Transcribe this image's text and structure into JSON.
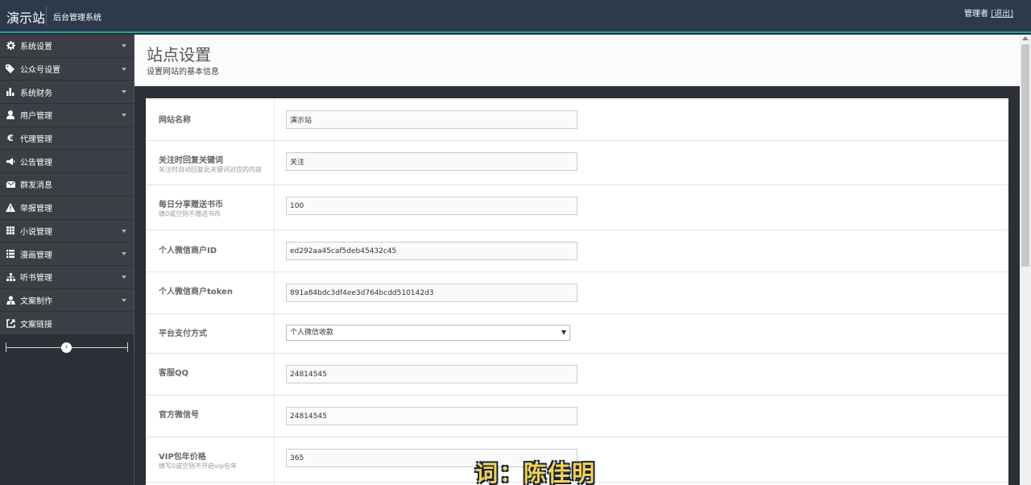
{
  "header": {
    "brand": "演示站",
    "subtitle": "后台管理系统",
    "user_name": "管理者",
    "logout_label": "[退出]"
  },
  "sidebar": {
    "items": [
      {
        "label": "系统设置",
        "icon": "gear-icon",
        "has_caret": true
      },
      {
        "label": "公众号设置",
        "icon": "tag-icon",
        "has_caret": true
      },
      {
        "label": "系统财务",
        "icon": "bar-chart-icon",
        "has_caret": true
      },
      {
        "label": "用户管理",
        "icon": "user-icon",
        "has_caret": true
      },
      {
        "label": "代理管理",
        "icon": "euro-icon",
        "has_caret": false
      },
      {
        "label": "公告管理",
        "icon": "megaphone-icon",
        "has_caret": false
      },
      {
        "label": "群发消息",
        "icon": "envelope-icon",
        "has_caret": false
      },
      {
        "label": "举报管理",
        "icon": "warning-icon",
        "has_caret": false
      },
      {
        "label": "小说管理",
        "icon": "grid-icon",
        "has_caret": true
      },
      {
        "label": "漫画管理",
        "icon": "list-icon",
        "has_caret": true
      },
      {
        "label": "听书管理",
        "icon": "sitemap-icon",
        "has_caret": true
      },
      {
        "label": "文案制作",
        "icon": "user-tie-icon",
        "has_caret": true
      },
      {
        "label": "文案链接",
        "icon": "external-link-icon",
        "has_caret": false
      }
    ],
    "collapse_symbol": "‹"
  },
  "page": {
    "title": "站点设置",
    "description": "设置网站的基本信息"
  },
  "form": {
    "rows": [
      {
        "label": "网站名称",
        "help": "",
        "value": "演示站",
        "type": "text"
      },
      {
        "label": "关注时回复关键词",
        "help": "关注时自动回复此关键词对应的内容",
        "value": "关注",
        "type": "text"
      },
      {
        "label": "每日分享赠送书币",
        "help": "填0或空则不赠送书币",
        "value": "100",
        "type": "text"
      },
      {
        "label": "个人微信商户ID",
        "help": "",
        "value": "ed292aa45caf5deb45432c45",
        "type": "text"
      },
      {
        "label": "个人微信商户token",
        "help": "",
        "value": "891a84bdc3df4ee3d764bcdd510142d3",
        "type": "text"
      },
      {
        "label": "平台支付方式",
        "help": "",
        "value": "个人微信收款",
        "type": "select"
      },
      {
        "label": "客服QQ",
        "help": "",
        "value": "24814545",
        "type": "text"
      },
      {
        "label": "官方微信号",
        "help": "",
        "value": "24814545",
        "type": "text"
      },
      {
        "label": "VIP包年价格",
        "help": "填写0或空则不开启vip包年",
        "value": "365",
        "type": "text"
      }
    ]
  },
  "overlay": {
    "caption": "词：陈佳明"
  },
  "colors": {
    "topbar": "#2c3a4c",
    "accent": "#1fa59a",
    "sidebar": "#3b3e44",
    "caption": "#f4d34a"
  }
}
